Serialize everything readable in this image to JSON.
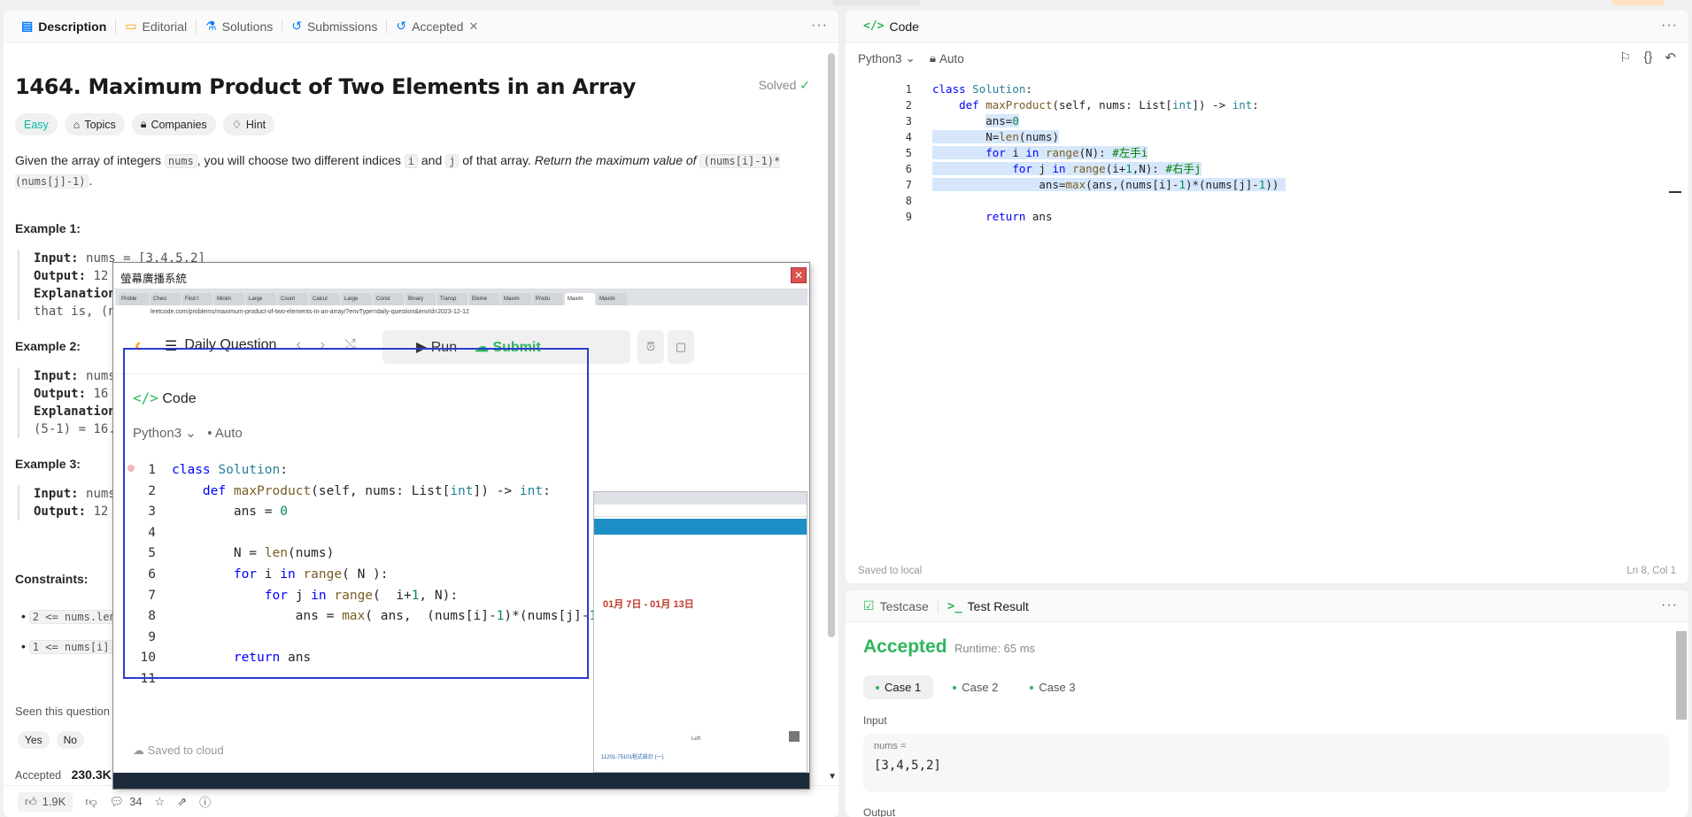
{
  "left_panel": {
    "tabs": [
      {
        "label": "Description",
        "icon": "document-icon"
      },
      {
        "label": "Editorial",
        "icon": "book-icon"
      },
      {
        "label": "Solutions",
        "icon": "flask-icon"
      },
      {
        "label": "Submissions",
        "icon": "history-icon"
      },
      {
        "label": "Accepted",
        "icon": "history-icon"
      }
    ],
    "problem_title": "1464. Maximum Product of Two Elements in an Array",
    "solved_label": "Solved",
    "tags": [
      "Easy",
      "Topics",
      "Companies",
      "Hint"
    ],
    "desc": {
      "p1": "Given the array of integers ",
      "c1": "nums",
      "p2": ", you will choose two different indices ",
      "c2": "i",
      "p3": " and ",
      "c3": "j",
      "p4": " of that array. ",
      "em": "Return the maximum value of",
      "c4": "(nums[i]-1)*(nums[j]-1)",
      "p5": "."
    },
    "examples": [
      {
        "title": "Example 1:",
        "input": "nums = [3,4,5,2]",
        "output": "12",
        "expl": "Explanation",
        "extra": "that is, (n"
      },
      {
        "title": "Example 2:",
        "input": "nums",
        "output": "16",
        "expl": "Explanation",
        "extra": "(5-1) = 16."
      },
      {
        "title": "Example 3:",
        "input": "nums",
        "output": "12"
      }
    ],
    "labels": {
      "input": "Input:",
      "output": "Output:"
    },
    "constraints_title": "Constraints:",
    "constraints": [
      "2 <= nums.len",
      "1 <= nums[i]"
    ],
    "seen_question": "Seen this question",
    "yes": "Yes",
    "no": "No",
    "accepted_label": "Accepted",
    "accepted_count": "230.3K",
    "likes": "1.9K",
    "comments": "34"
  },
  "code_panel": {
    "title": "Code",
    "language": "Python3",
    "mode": "Auto",
    "line_numbers": [
      "1",
      "2",
      "3",
      "4",
      "5",
      "6",
      "7",
      "8",
      "9"
    ],
    "saved": "Saved to local",
    "cursor": "Ln 8, Col 1"
  },
  "result_panel": {
    "tabs": [
      "Testcase",
      "Test Result"
    ],
    "status": "Accepted",
    "runtime": "Runtime: 65 ms",
    "cases": [
      "Case 1",
      "Case 2",
      "Case 3"
    ],
    "input_label": "Input",
    "var_label": "nums =",
    "var_value": "[3,4,5,2]",
    "output_label": "Output"
  },
  "overlay": {
    "title": "螢幕廣播系統",
    "url": "leetcode.com/problems/maximum-product-of-two-elements-in-an-array/?envType=daily-question&envId=2023-12-12",
    "daily": "Daily Question",
    "run": "Run",
    "submit": "Submit",
    "code_title": "Code",
    "language": "Python3",
    "mode": "Auto",
    "line_numbers": [
      "1",
      "2",
      "3",
      "4",
      "5",
      "6",
      "7",
      "8",
      "9",
      "10",
      "11"
    ],
    "saved": "Saved to cloud",
    "side_date": "01月 7日 - 01月 13日",
    "side_footer": "11201-75101程式設計 (一)",
    "side_left": "Left"
  }
}
